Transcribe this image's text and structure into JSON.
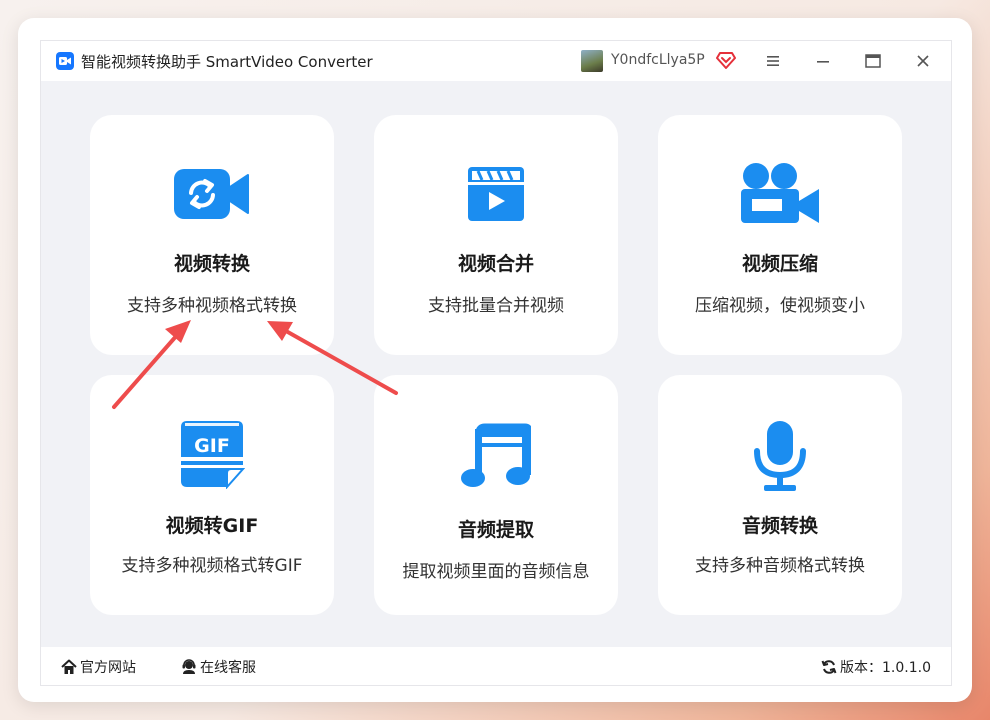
{
  "window": {
    "title": "智能视频转换助手 SmartVideo Converter",
    "username": "Y0ndfcLlya5P"
  },
  "colors": {
    "accent": "#1b8df0",
    "vip": "#e5303a",
    "arrow": "#ee4c4c"
  },
  "tiles": [
    {
      "icon": "video-convert-icon",
      "title": "视频转换",
      "desc": "支持多种视频格式转换"
    },
    {
      "icon": "clapperboard-icon",
      "title": "视频合并",
      "desc": "支持批量合并视频"
    },
    {
      "icon": "video-camera-icon",
      "title": "视频压缩",
      "desc": "压缩视频，使视频变小"
    },
    {
      "icon": "gif-file-icon",
      "title": "视频转GIF",
      "desc": "支持多种视频格式转GIF"
    },
    {
      "icon": "music-note-icon",
      "title": "音频提取",
      "desc": "提取视频里面的音频信息"
    },
    {
      "icon": "microphone-icon",
      "title": "音频转换",
      "desc": "支持多种音频格式转换"
    }
  ],
  "footer": {
    "website": "官方网站",
    "support": "在线客服",
    "version": "版本：1.0.1.0"
  }
}
